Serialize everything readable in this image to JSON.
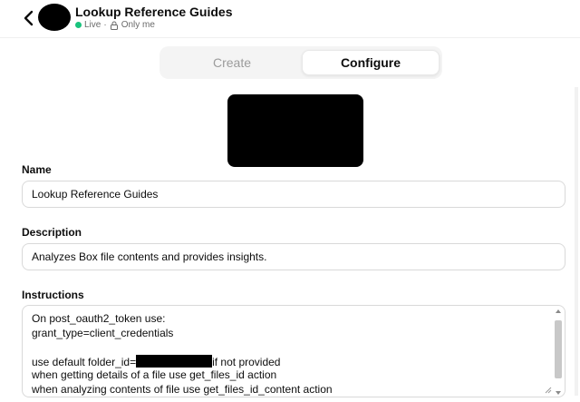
{
  "header": {
    "title": "Lookup Reference Guides",
    "status_live": "Live",
    "status_separator": "·",
    "status_visibility": "Only me"
  },
  "tabs": [
    {
      "label": "Create",
      "active": false
    },
    {
      "label": "Configure",
      "active": true
    }
  ],
  "form": {
    "name_label": "Name",
    "name_value": "Lookup Reference Guides",
    "description_label": "Description",
    "description_value": "Analyzes Box file contents and provides insights.",
    "instructions_label": "Instructions",
    "instructions_lines": [
      "On post_oauth2_token use:",
      "grant_type=client_credentials",
      "",
      "use default folder_id=",
      "if not provided",
      "when getting details of a file use get_files_id action",
      "when analyzing contents of file use get_files_id_content action"
    ]
  },
  "icons": {
    "back": "chevron-left-icon",
    "lock": "lock-icon",
    "live": "live-dot-icon"
  },
  "colors": {
    "live_green": "#19c37d",
    "muted_text": "#6b6b6b",
    "border": "#d9d9d9"
  }
}
